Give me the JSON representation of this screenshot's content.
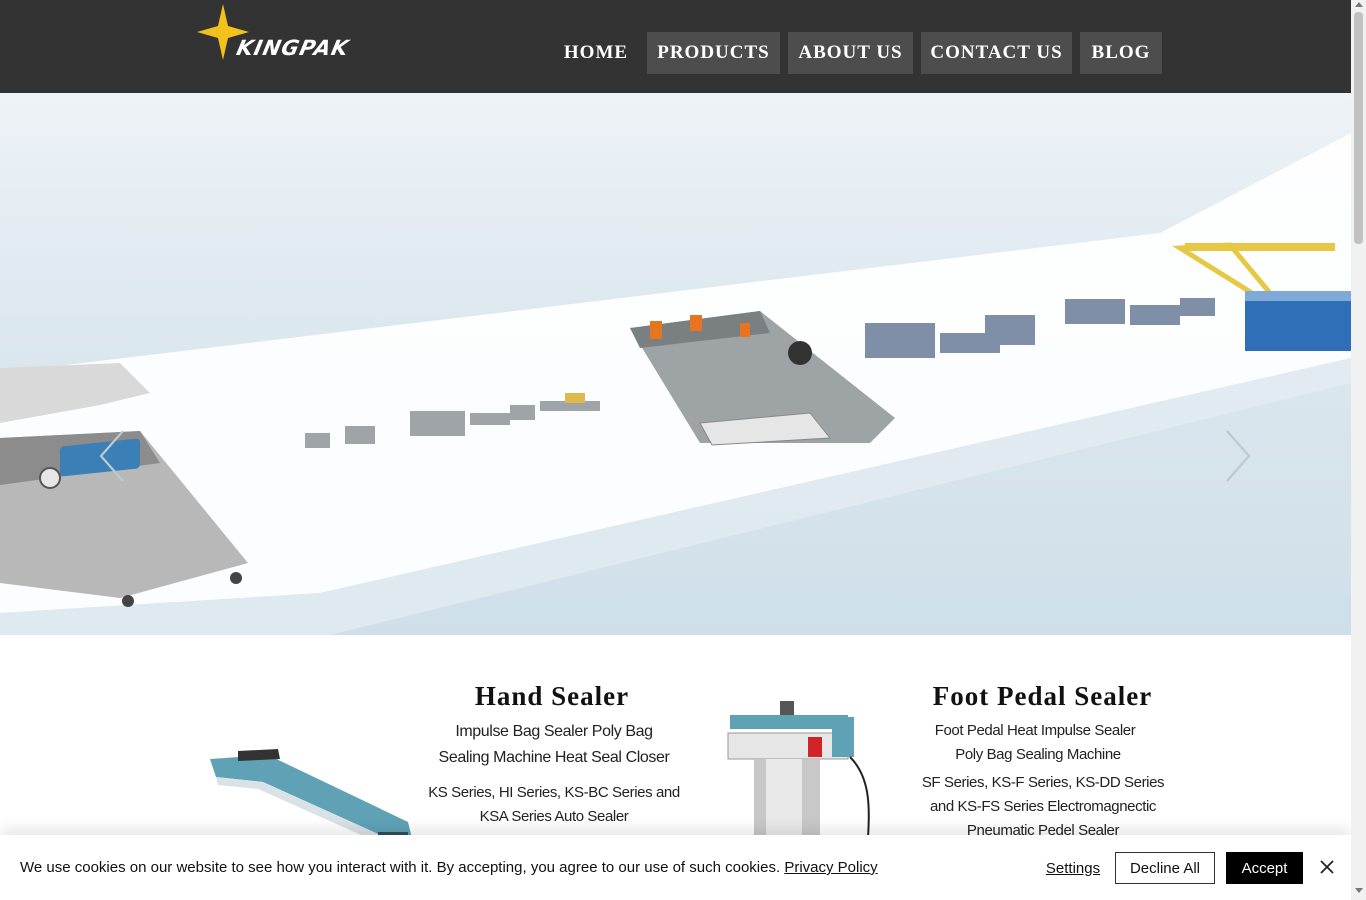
{
  "brand": {
    "logo_text": "KINGPAK",
    "accent_color": "#f2c21b"
  },
  "nav": {
    "items": [
      {
        "label": "HOME"
      },
      {
        "label": "PRODUCTS"
      },
      {
        "label": "ABOUT US"
      },
      {
        "label": "CONTACT US"
      },
      {
        "label": "BLOG"
      }
    ]
  },
  "hero": {
    "prev_icon": "chevron-left-icon",
    "next_icon": "chevron-right-icon"
  },
  "products": [
    {
      "title": "Hand Sealer",
      "line1": "Impulse Bag Sealer Poly Bag",
      "line2": "Sealing Machine Heat Seal Closer",
      "series1": "KS Series, HI Series, KS-BC Series and",
      "series2": "KSA Series Auto Sealer"
    },
    {
      "title": "Foot Pedal Sealer",
      "line1": "Foot Pedal Heat Impulse Sealer",
      "line2": "Poly Bag Sealing Machine",
      "series1": "SF Series, KS-F Series, KS-DD Series",
      "series2": "and KS-FS Series Electromagnectic",
      "series3": "Pneumatic Pedel Sealer"
    }
  ],
  "cookie": {
    "message": "We use cookies on our website to see how you interact with it. By accepting, you agree to our use of such cookies.",
    "policy_link": "Privacy Policy",
    "settings_label": "Settings",
    "decline_label": "Decline All",
    "accept_label": "Accept"
  }
}
